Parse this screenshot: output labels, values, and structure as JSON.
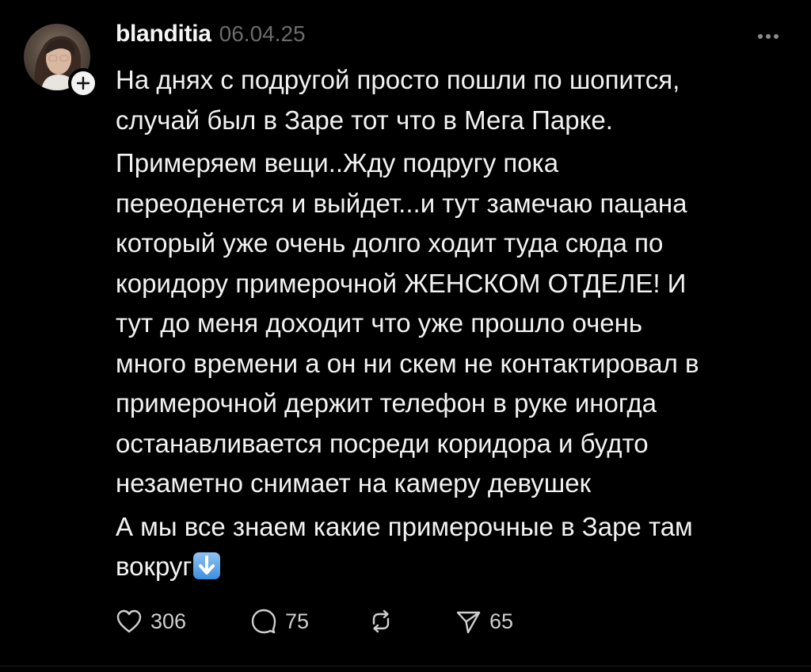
{
  "post": {
    "username": "blanditia",
    "date": "06.04.25",
    "avatar_icon": "profile-photo",
    "follow_icon": "plus-icon",
    "more_icon": "ellipsis-icon",
    "paragraphs": [
      [
        "На днях с подругой просто пошли по шопится,",
        "случай был в Заре тот что в Мега Парке."
      ],
      [
        "Примеряем вещи..Жду подругу пока",
        "переоденется и выйдет...и тут замечаю пацана",
        "который уже очень долго ходит туда сюда  по",
        "коридору примерочной ЖЕНСКОМ ОТДЕЛЕ! И",
        "тут до меня доходит что уже прошло очень",
        "много времени а он ни скем не контактировал в",
        "примерочной держит телефон в руке иногда",
        "останавливается посреди коридора и будто",
        "незаметно снимает на камеру девушек"
      ],
      [
        "А мы все знаем какие примерочные в Заре там",
        "вокруг"
      ]
    ],
    "end_emoji": "down-arrow-emoji",
    "actions": {
      "likes": "306",
      "comments": "75",
      "reposts": "",
      "shares": "65"
    }
  },
  "colors": {
    "background": "#000000",
    "text": "#f2f2f2",
    "muted": "#6b6b6b",
    "icon": "#cfcfcf",
    "emoji_blue": "#4a94df"
  }
}
